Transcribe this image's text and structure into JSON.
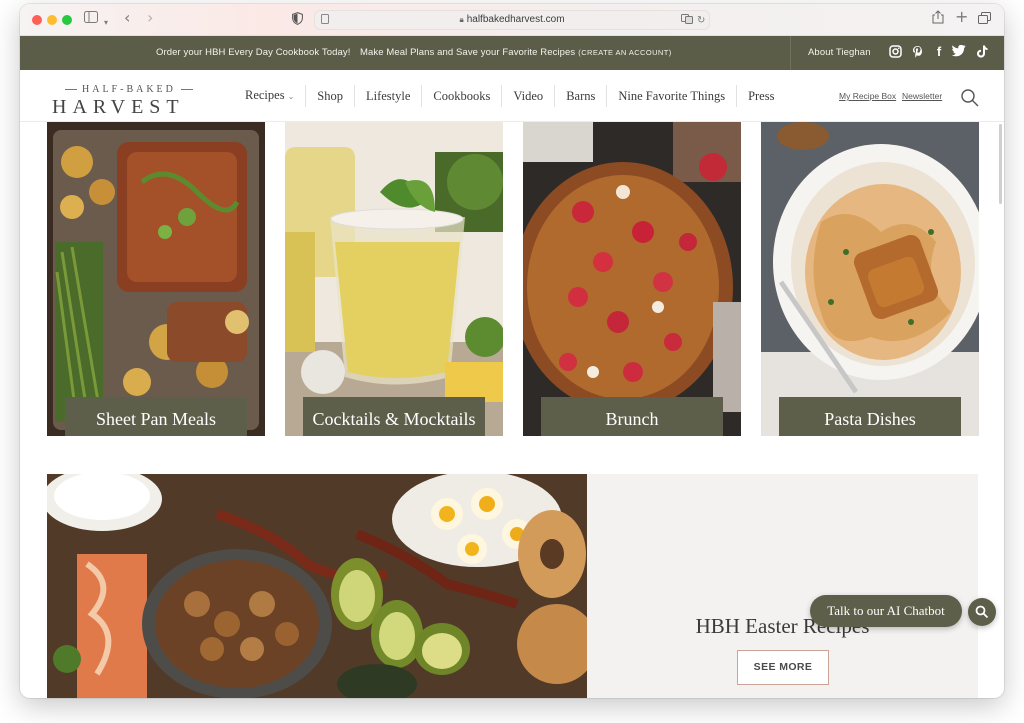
{
  "browser": {
    "url": "halfbakedharvest.com",
    "back_icon": "chevron-left-icon",
    "forward_icon": "chevron-right-icon"
  },
  "promo": {
    "cookbook_text": "Order your HBH Every Day Cookbook Today!",
    "meal_plans_text": "Make Meal Plans and Save your Favorite Recipes",
    "create_account_text": "(CREATE AN ACCOUNT)",
    "about_text": "About Tieghan",
    "social_icons": [
      "instagram-icon",
      "pinterest-icon",
      "facebook-icon",
      "twitter-icon",
      "tiktok-icon"
    ]
  },
  "header": {
    "logo_top": "HALF-BAKED",
    "logo_main": "HARVEST",
    "nav": [
      "Recipes",
      "Shop",
      "Lifestyle",
      "Cookbooks",
      "Video",
      "Barns",
      "Nine Favorite Things",
      "Press"
    ],
    "recipe_box": "My Recipe Box",
    "newsletter": "Newsletter"
  },
  "tiles": [
    {
      "label": "Sheet Pan Meals"
    },
    {
      "label": "Cocktails & Mocktails"
    },
    {
      "label": "Brunch"
    },
    {
      "label": "Pasta Dishes"
    }
  ],
  "feature": {
    "title": "HBH Easter Recipes",
    "button": "SEE MORE"
  },
  "chatbot": {
    "label": "Talk to our AI Chatbot"
  },
  "colors": {
    "olive": "#5b5d48",
    "label_bg": "#5d5f4a",
    "panel_bg": "#f3f2f1",
    "button_border": "#c9a497"
  }
}
